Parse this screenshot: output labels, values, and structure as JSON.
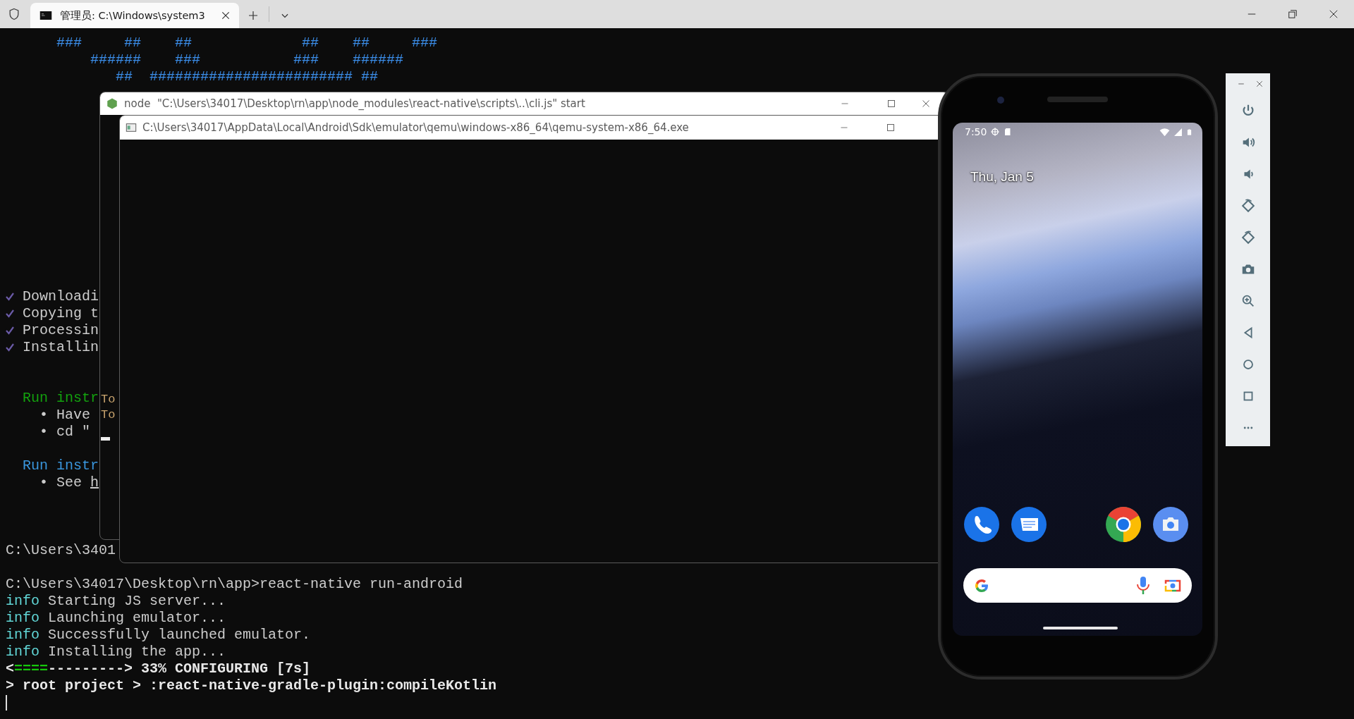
{
  "terminal_window": {
    "tab": {
      "title": "管理员:  C:\\Windows\\system3",
      "selected": true
    },
    "lines": [
      {
        "kind": "ascii",
        "text": "      ###     ##    ##             ##    ##     ###"
      },
      {
        "kind": "ascii",
        "text": "          ######    ###           ###    ######"
      },
      {
        "kind": "ascii",
        "text": "             ##  ######################## ##"
      },
      {
        "kind": "blank"
      },
      {
        "kind": "blank"
      },
      {
        "kind": "blank"
      },
      {
        "kind": "blank"
      },
      {
        "kind": "blank"
      },
      {
        "kind": "blank"
      },
      {
        "kind": "blank"
      },
      {
        "kind": "blank"
      },
      {
        "kind": "blank"
      },
      {
        "kind": "blank"
      },
      {
        "kind": "blank"
      },
      {
        "kind": "blank"
      },
      {
        "kind": "check",
        "text": "Downloadi"
      },
      {
        "kind": "check",
        "text": "Copying t"
      },
      {
        "kind": "check",
        "text": "Processin"
      },
      {
        "kind": "check",
        "text": "Installin"
      },
      {
        "kind": "blank"
      },
      {
        "kind": "blank"
      },
      {
        "kind": "heading",
        "text": "Run instr",
        "color": "#13a10e"
      },
      {
        "kind": "bullet",
        "bullet": "•",
        "text": "Have"
      },
      {
        "kind": "bullet",
        "bullet": "•",
        "text": "cd \""
      },
      {
        "kind": "blank"
      },
      {
        "kind": "heading",
        "text": "Run instr",
        "color": "#3a96dd"
      },
      {
        "kind": "bullet",
        "bullet": "•",
        "text": "See",
        "link": "h"
      },
      {
        "kind": "blank"
      },
      {
        "kind": "blank"
      },
      {
        "kind": "blank"
      },
      {
        "kind": "plain",
        "text": "C:\\Users\\3401"
      },
      {
        "kind": "blank"
      },
      {
        "kind": "plain",
        "text": "C:\\Users\\34017\\Desktop\\rn\\app>react-native run-android"
      },
      {
        "kind": "info",
        "tag": "info",
        "text": "Starting JS server..."
      },
      {
        "kind": "info",
        "tag": "info",
        "text": "Launching emulator..."
      },
      {
        "kind": "info",
        "tag": "info",
        "text": "Successfully launched emulator."
      },
      {
        "kind": "info",
        "tag": "info",
        "text": "Installing the app..."
      },
      {
        "kind": "progress",
        "open": "<",
        "done": "====",
        "rest": "---------> 33% CONFIGURING [7s]"
      },
      {
        "kind": "task",
        "text": "> root project > :react-native-gradle-plugin:compileKotlin"
      },
      {
        "kind": "cursor"
      }
    ]
  },
  "node_window": {
    "title": "node  \"C:\\Users\\34017\\Desktop\\rn\\app\\node_modules\\react-native\\scripts\\..\\cli.js\" start",
    "lines": [
      "To",
      "To"
    ]
  },
  "qemu_window": {
    "title": "C:\\Users\\34017\\AppData\\Local\\Android\\Sdk\\emulator\\qemu\\windows-x86_64\\qemu-system-x86_64.exe"
  },
  "phone": {
    "time": "7:50",
    "date": "Thu, Jan 5"
  }
}
